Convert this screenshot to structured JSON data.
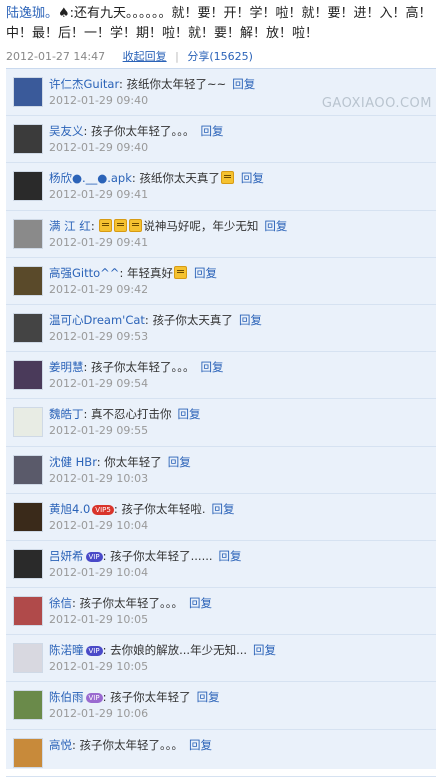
{
  "post": {
    "author": "陆逸珈。",
    "text": "♠:还有九天。。。。。。就！要！开！学！啦！就！要！进！入！高！中！最！后！一！学！期！啦！就！要！解！放！啦！",
    "timestamp": "2012-01-27 14:47",
    "collapse_label": "收起回复",
    "share_label": "分享(15625)"
  },
  "watermark": "GAOXIAOO.COM",
  "reply_label": "回复",
  "comments": [
    {
      "name": "许仁杰Guitar",
      "badge": "",
      "text": "孩纸你太年轻了~~",
      "emoji_count": 0,
      "time": "2012-01-29 09:40",
      "avatar_color": "#3a5a9a"
    },
    {
      "name": "吴友义",
      "badge": "",
      "text": "孩子你太年轻了。。。",
      "emoji_count": 0,
      "time": "2012-01-29 09:40",
      "avatar_color": "#3b3b3b"
    },
    {
      "name": "杨欣●.__●.apk",
      "badge": "",
      "text": "孩纸你太天真了",
      "emoji_count": 1,
      "time": "2012-01-29 09:41",
      "avatar_color": "#2a2a2a"
    },
    {
      "name": "满 江 红",
      "badge": "",
      "text": "说神马好呢，年少无知",
      "emoji_count": 3,
      "emoji_first": true,
      "time": "2012-01-29 09:41",
      "avatar_color": "#8a8a8a"
    },
    {
      "name": "高强Gitto^^",
      "badge": "",
      "text": "年轻真好",
      "emoji_count": 1,
      "time": "2012-01-29 09:42",
      "avatar_color": "#5a4a2a"
    },
    {
      "name": "温可心Dream'Cat",
      "badge": "",
      "text": "孩子你太天真了",
      "emoji_count": 0,
      "time": "2012-01-29 09:53",
      "avatar_color": "#444444"
    },
    {
      "name": "姜明慧",
      "badge": "",
      "text": "孩子你太年轻了。。。",
      "emoji_count": 0,
      "time": "2012-01-29 09:54",
      "avatar_color": "#4a3a5a"
    },
    {
      "name": "魏皓丁",
      "badge": "",
      "text": "真不忍心打击你",
      "emoji_count": 0,
      "time": "2012-01-29 09:55",
      "avatar_color": "#e8ece4"
    },
    {
      "name": "沈健 HBr",
      "badge": "",
      "text": "你太年轻了",
      "emoji_count": 0,
      "time": "2012-01-29 10:03",
      "avatar_color": "#5a5a6a"
    },
    {
      "name": "黄旭4.0",
      "badge": "VIP5",
      "badge_color": "#d9342b",
      "text": "孩子你太年轻啦.",
      "emoji_count": 0,
      "time": "2012-01-29 10:04",
      "avatar_color": "#3a2a1a"
    },
    {
      "name": "吕妍希",
      "badge": "VIP",
      "badge_color": "#4a4ac8",
      "text": "孩子你太年轻了......",
      "emoji_count": 0,
      "time": "2012-01-29 10:04",
      "avatar_color": "#2a2a2a"
    },
    {
      "name": "徐信",
      "badge": "",
      "text": "孩子你太年轻了。。。",
      "emoji_count": 0,
      "time": "2012-01-29 10:05",
      "avatar_color": "#b04a4a"
    },
    {
      "name": "陈渃曈",
      "badge": "VIP",
      "badge_color": "#4a4ac8",
      "text": "去你娘的解放...年少无知...",
      "emoji_count": 0,
      "time": "2012-01-29 10:05",
      "avatar_color": "#d8d8e0"
    },
    {
      "name": "陈伯雨",
      "badge": "VIP",
      "badge_color": "#9a6ad0",
      "text": "孩子你太年轻了",
      "emoji_count": 0,
      "time": "2012-01-29 10:06",
      "avatar_color": "#6a8a4a"
    },
    {
      "name": "高悦",
      "badge": "",
      "text": "孩子你太年轻了。。。",
      "emoji_count": 0,
      "time": "",
      "avatar_color": "#c88a3a"
    }
  ]
}
